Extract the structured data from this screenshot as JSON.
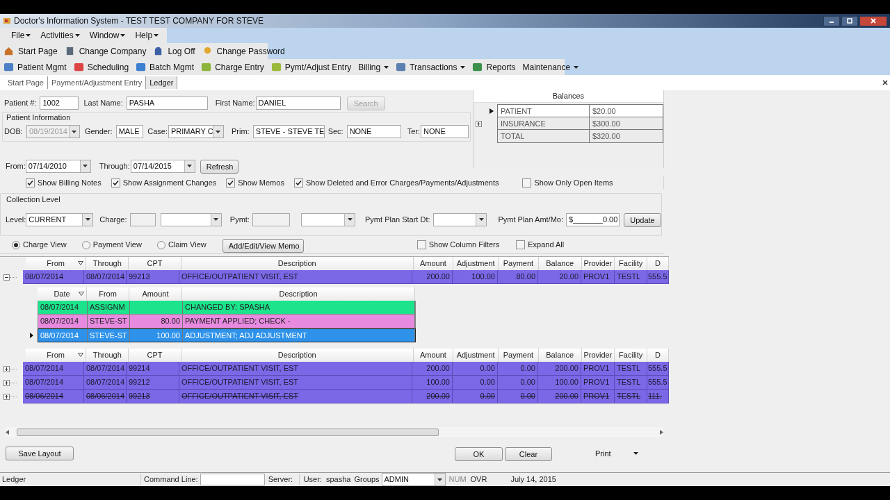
{
  "window": {
    "title": "Doctor's Information System - TEST TEST COMPANY FOR STEVE"
  },
  "menu": [
    {
      "label": "File",
      "dropdown": true
    },
    {
      "label": "Activities",
      "dropdown": true
    },
    {
      "label": "Window",
      "dropdown": true
    },
    {
      "label": "Help",
      "dropdown": true
    }
  ],
  "toolbar_top": [
    {
      "label": "Start Page"
    },
    {
      "label": "Change Company"
    },
    {
      "label": "Log Off"
    },
    {
      "label": "Change Password"
    }
  ],
  "toolbar_main": [
    {
      "label": "Patient Mgmt",
      "kind": "button",
      "dropdown": false
    },
    {
      "label": "Scheduling",
      "kind": "button",
      "dropdown": false
    },
    {
      "label": "Batch Mgmt",
      "kind": "button",
      "dropdown": false
    },
    {
      "label": "Charge Entry",
      "kind": "button",
      "dropdown": false
    },
    {
      "label": "Pymt/Adjust Entry",
      "kind": "button",
      "dropdown": false
    },
    {
      "label": "Billing",
      "kind": "menu",
      "dropdown": true
    },
    {
      "label": "Transactions",
      "kind": "button",
      "dropdown": true
    },
    {
      "label": "Reports",
      "kind": "button",
      "dropdown": false
    },
    {
      "label": "Maintenance",
      "kind": "menu",
      "dropdown": true
    }
  ],
  "tabs": [
    {
      "label": "Start Page",
      "selected": false
    },
    {
      "label": "Payment/Adjustment Entry",
      "selected": false
    },
    {
      "label": "Ledger",
      "selected": true
    }
  ],
  "search": {
    "patient_no": {
      "label": "Patient #:",
      "value": "1002"
    },
    "last_name": {
      "label": "Last Name:",
      "value": "PASHA"
    },
    "first_name": {
      "label": "First Name:",
      "value": "DANIEL"
    },
    "button": {
      "label": "Search",
      "disabled": true
    }
  },
  "patient_info": {
    "title": "Patient Information",
    "dob": {
      "label": "DOB:",
      "value": "08/19/2014",
      "disabled": true
    },
    "gender": {
      "label": "Gender:",
      "value": "MALE"
    },
    "case": {
      "label": "Case:",
      "value": "PRIMARY C"
    },
    "prim": {
      "label": "Prim:",
      "value": "STEVE - STEVE TE"
    },
    "sec": {
      "label": "Sec:",
      "value": "NONE"
    },
    "ter": {
      "label": "Ter:",
      "value": "NONE"
    }
  },
  "balances": {
    "title": "Balances",
    "rows": [
      {
        "label": "PATIENT",
        "amount": "$20.00",
        "selected": true
      },
      {
        "label": "INSURANCE",
        "amount": "$300.00",
        "selected": false
      },
      {
        "label": "TOTAL",
        "amount": "$320.00",
        "selected": false
      }
    ]
  },
  "dates": {
    "from": {
      "label": "From:",
      "value": "07/14/2010"
    },
    "through": {
      "label": "Through:",
      "value": "07/14/2015"
    },
    "button": "Refresh"
  },
  "options": [
    {
      "label": "Show Billing Notes",
      "checked": true
    },
    {
      "label": "Show Assignment Changes",
      "checked": true
    },
    {
      "label": "Show Memos",
      "checked": true
    },
    {
      "label": "Show Deleted and Error Charges/Payments/Adjustments",
      "checked": true
    },
    {
      "label": "Show Only Open Items",
      "checked": false
    }
  ],
  "collection": {
    "title": "Collection Level",
    "level": {
      "label": "Level:",
      "value": "CURRENT"
    },
    "charge_label": "Charge:",
    "pymt_label": "Pymt:",
    "plan_start_label": "Pymt Plan Start Dt:",
    "plan_amt": {
      "label": "Pymt Plan Amt/Mo:",
      "value": "$_______0.00"
    },
    "button": "Update"
  },
  "views": [
    {
      "label": "Charge View",
      "selected": true
    },
    {
      "label": "Payment View",
      "selected": false
    },
    {
      "label": "Claim View",
      "selected": false
    }
  ],
  "memo_button": "Add/Edit/View Memo",
  "view_options": [
    {
      "label": "Show Column Filters",
      "checked": false
    },
    {
      "label": "Expand All",
      "checked": false
    }
  ],
  "grid": {
    "sections": [
      {
        "columns": [
          "From",
          "Through",
          "CPT",
          "Description",
          "Amount",
          "Adjustment",
          "Payment",
          "Balance",
          "Provider",
          "Facility",
          "D"
        ],
        "rows": [
          {
            "expanded": true,
            "deleted": false,
            "cells": [
              "08/07/2014",
              "08/07/2014",
              "99213",
              "OFFICE/OUTPATIENT VISIT, EST",
              "200.00",
              "100.00",
              "80.00",
              "20.00",
              "PROV1",
              "TESTL",
              "555.5"
            ],
            "details": {
              "columns": [
                "Date",
                "From",
                "Amount",
                "Description"
              ],
              "rows": [
                {
                  "color": "#1de38c",
                  "selected": false,
                  "cells": [
                    "08/07/2014",
                    "ASSIGNM",
                    null,
                    "CHANGED BY:  SPASHA"
                  ]
                },
                {
                  "color": "#e88be0",
                  "selected": false,
                  "cells": [
                    "08/07/2014",
                    "STEVE-ST",
                    "80.00",
                    "PAYMENT APPLIED; CHECK -"
                  ]
                },
                {
                  "color": "#2e92ea",
                  "selected": true,
                  "cells": [
                    "08/07/2014",
                    "STEVE-ST",
                    "100.00",
                    "ADJUSTMENT; ADJ ADJUSTMENT"
                  ]
                }
              ]
            }
          }
        ]
      },
      {
        "columns": [
          "From",
          "Through",
          "CPT",
          "Description",
          "Amount",
          "Adjustment",
          "Payment",
          "Balance",
          "Provider",
          "Facility",
          "D"
        ],
        "rows": [
          {
            "expanded": false,
            "deleted": false,
            "cells": [
              "08/07/2014",
              "08/07/2014",
              "99214",
              "OFFICE/OUTPATIENT VISIT, EST",
              "200.00",
              "0.00",
              "0.00",
              "200.00",
              "PROV1",
              "TESTL",
              "555.5"
            ]
          },
          {
            "expanded": false,
            "deleted": false,
            "cells": [
              "08/07/2014",
              "08/07/2014",
              "99212",
              "OFFICE/OUTPATIENT VISIT, EST",
              "100.00",
              "0.00",
              "0.00",
              "100.00",
              "PROV1",
              "TESTL",
              "555.5"
            ]
          },
          {
            "expanded": false,
            "deleted": true,
            "cells": [
              "08/06/2014",
              "08/06/2014",
              "99213",
              "OFFICE/OUTPATIENT VISIT, EST",
              "200.00",
              "0.00",
              "0.00",
              "200.00",
              "PROV1",
              "TESTL",
              "111."
            ]
          }
        ]
      }
    ]
  },
  "footer": {
    "save_layout": "Save Layout",
    "ok": "OK",
    "clear": "Clear",
    "print": "Print"
  },
  "status_bar": {
    "screen": "Ledger",
    "command_label": "Command Line:",
    "server_label": "Server:",
    "user_label": "User:",
    "user": "spasha",
    "groups_label": "Groups",
    "group": "ADMIN",
    "num": "NUM",
    "ovr": "OVR",
    "date": "July 14, 2015"
  }
}
